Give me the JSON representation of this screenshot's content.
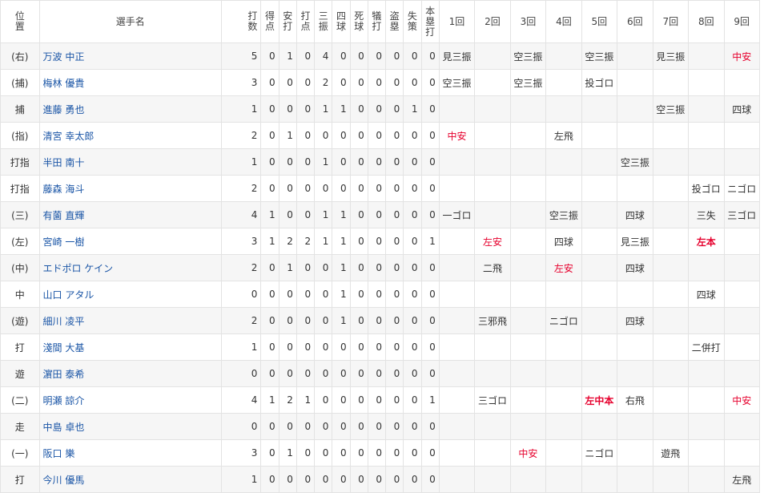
{
  "headers": {
    "position": "位置",
    "name": "選手名",
    "stats": [
      "打数",
      "得点",
      "安打",
      "打点",
      "三振",
      "四球",
      "死球",
      "犠打",
      "盗塁",
      "失策",
      "本塁打"
    ],
    "innings": [
      "1回",
      "2回",
      "3回",
      "4回",
      "5回",
      "6回",
      "7回",
      "8回",
      "9回"
    ]
  },
  "rows": [
    {
      "pos": "(右)",
      "name": "万波 中正",
      "stats": [
        "5",
        "0",
        "1",
        "0",
        "4",
        "0",
        "0",
        "0",
        "0",
        "0",
        "0"
      ],
      "innings": [
        {
          "t": "見三振"
        },
        {
          "t": ""
        },
        {
          "t": "空三振"
        },
        {
          "t": ""
        },
        {
          "t": "空三振"
        },
        {
          "t": ""
        },
        {
          "t": "見三振"
        },
        {
          "t": ""
        },
        {
          "t": "中安",
          "c": "hit"
        }
      ]
    },
    {
      "pos": "(捕)",
      "name": "梅林 優貴",
      "stats": [
        "3",
        "0",
        "0",
        "0",
        "2",
        "0",
        "0",
        "0",
        "0",
        "0",
        "0"
      ],
      "innings": [
        {
          "t": "空三振"
        },
        {
          "t": ""
        },
        {
          "t": "空三振"
        },
        {
          "t": ""
        },
        {
          "t": "投ゴロ"
        },
        {
          "t": ""
        },
        {
          "t": ""
        },
        {
          "t": ""
        },
        {
          "t": ""
        }
      ]
    },
    {
      "pos": "捕",
      "name": "進藤 勇也",
      "stats": [
        "1",
        "0",
        "0",
        "0",
        "1",
        "1",
        "0",
        "0",
        "0",
        "1",
        "0"
      ],
      "innings": [
        {
          "t": ""
        },
        {
          "t": ""
        },
        {
          "t": ""
        },
        {
          "t": ""
        },
        {
          "t": ""
        },
        {
          "t": ""
        },
        {
          "t": "空三振"
        },
        {
          "t": ""
        },
        {
          "t": "四球"
        }
      ]
    },
    {
      "pos": "(指)",
      "name": "清宮 幸太郎",
      "stats": [
        "2",
        "0",
        "1",
        "0",
        "0",
        "0",
        "0",
        "0",
        "0",
        "0",
        "0"
      ],
      "innings": [
        {
          "t": "中安",
          "c": "hit"
        },
        {
          "t": ""
        },
        {
          "t": ""
        },
        {
          "t": "左飛"
        },
        {
          "t": ""
        },
        {
          "t": ""
        },
        {
          "t": ""
        },
        {
          "t": ""
        },
        {
          "t": ""
        }
      ]
    },
    {
      "pos": "打指",
      "name": "半田 南十",
      "stats": [
        "1",
        "0",
        "0",
        "0",
        "1",
        "0",
        "0",
        "0",
        "0",
        "0",
        "0"
      ],
      "innings": [
        {
          "t": ""
        },
        {
          "t": ""
        },
        {
          "t": ""
        },
        {
          "t": ""
        },
        {
          "t": ""
        },
        {
          "t": "空三振"
        },
        {
          "t": ""
        },
        {
          "t": ""
        },
        {
          "t": ""
        }
      ]
    },
    {
      "pos": "打指",
      "name": "藤森 海斗",
      "stats": [
        "2",
        "0",
        "0",
        "0",
        "0",
        "0",
        "0",
        "0",
        "0",
        "0",
        "0"
      ],
      "innings": [
        {
          "t": ""
        },
        {
          "t": ""
        },
        {
          "t": ""
        },
        {
          "t": ""
        },
        {
          "t": ""
        },
        {
          "t": ""
        },
        {
          "t": ""
        },
        {
          "t": "投ゴロ"
        },
        {
          "t": "ニゴロ"
        }
      ]
    },
    {
      "pos": "(三)",
      "name": "有薗 直輝",
      "stats": [
        "4",
        "1",
        "0",
        "0",
        "1",
        "1",
        "0",
        "0",
        "0",
        "0",
        "0"
      ],
      "innings": [
        {
          "t": "一ゴロ"
        },
        {
          "t": ""
        },
        {
          "t": ""
        },
        {
          "t": "空三振"
        },
        {
          "t": ""
        },
        {
          "t": "四球"
        },
        {
          "t": ""
        },
        {
          "t": "三失"
        },
        {
          "t": "三ゴロ"
        }
      ]
    },
    {
      "pos": "(左)",
      "name": "宮崎 一樹",
      "stats": [
        "3",
        "1",
        "2",
        "2",
        "1",
        "1",
        "0",
        "0",
        "0",
        "0",
        "1"
      ],
      "innings": [
        {
          "t": ""
        },
        {
          "t": "左安",
          "c": "hit"
        },
        {
          "t": ""
        },
        {
          "t": "四球"
        },
        {
          "t": ""
        },
        {
          "t": "見三振"
        },
        {
          "t": ""
        },
        {
          "t": "左本",
          "c": "hr"
        },
        {
          "t": ""
        }
      ]
    },
    {
      "pos": "(中)",
      "name": "エドポロ ケイン",
      "stats": [
        "2",
        "0",
        "1",
        "0",
        "0",
        "1",
        "0",
        "0",
        "0",
        "0",
        "0"
      ],
      "innings": [
        {
          "t": ""
        },
        {
          "t": "二飛"
        },
        {
          "t": ""
        },
        {
          "t": "左安",
          "c": "hit"
        },
        {
          "t": ""
        },
        {
          "t": "四球"
        },
        {
          "t": ""
        },
        {
          "t": ""
        },
        {
          "t": ""
        }
      ]
    },
    {
      "pos": "中",
      "name": "山口 アタル",
      "stats": [
        "0",
        "0",
        "0",
        "0",
        "0",
        "1",
        "0",
        "0",
        "0",
        "0",
        "0"
      ],
      "innings": [
        {
          "t": ""
        },
        {
          "t": ""
        },
        {
          "t": ""
        },
        {
          "t": ""
        },
        {
          "t": ""
        },
        {
          "t": ""
        },
        {
          "t": ""
        },
        {
          "t": "四球"
        },
        {
          "t": ""
        }
      ]
    },
    {
      "pos": "(遊)",
      "name": "細川 凌平",
      "stats": [
        "2",
        "0",
        "0",
        "0",
        "0",
        "1",
        "0",
        "0",
        "0",
        "0",
        "0"
      ],
      "innings": [
        {
          "t": ""
        },
        {
          "t": "三邪飛"
        },
        {
          "t": ""
        },
        {
          "t": "ニゴロ"
        },
        {
          "t": ""
        },
        {
          "t": "四球"
        },
        {
          "t": ""
        },
        {
          "t": ""
        },
        {
          "t": ""
        }
      ]
    },
    {
      "pos": "打",
      "name": "淺間 大基",
      "stats": [
        "1",
        "0",
        "0",
        "0",
        "0",
        "0",
        "0",
        "0",
        "0",
        "0",
        "0"
      ],
      "innings": [
        {
          "t": ""
        },
        {
          "t": ""
        },
        {
          "t": ""
        },
        {
          "t": ""
        },
        {
          "t": ""
        },
        {
          "t": ""
        },
        {
          "t": ""
        },
        {
          "t": "二併打"
        },
        {
          "t": ""
        }
      ]
    },
    {
      "pos": "遊",
      "name": "濵田 泰希",
      "stats": [
        "0",
        "0",
        "0",
        "0",
        "0",
        "0",
        "0",
        "0",
        "0",
        "0",
        "0"
      ],
      "innings": [
        {
          "t": ""
        },
        {
          "t": ""
        },
        {
          "t": ""
        },
        {
          "t": ""
        },
        {
          "t": ""
        },
        {
          "t": ""
        },
        {
          "t": ""
        },
        {
          "t": ""
        },
        {
          "t": ""
        }
      ]
    },
    {
      "pos": "(二)",
      "name": "明瀬 諒介",
      "stats": [
        "4",
        "1",
        "2",
        "1",
        "0",
        "0",
        "0",
        "0",
        "0",
        "0",
        "1"
      ],
      "innings": [
        {
          "t": ""
        },
        {
          "t": "三ゴロ"
        },
        {
          "t": ""
        },
        {
          "t": ""
        },
        {
          "t": "左中本",
          "c": "hr"
        },
        {
          "t": "右飛"
        },
        {
          "t": ""
        },
        {
          "t": ""
        },
        {
          "t": "中安",
          "c": "hit"
        }
      ]
    },
    {
      "pos": "走",
      "name": "中島 卓也",
      "stats": [
        "0",
        "0",
        "0",
        "0",
        "0",
        "0",
        "0",
        "0",
        "0",
        "0",
        "0"
      ],
      "innings": [
        {
          "t": ""
        },
        {
          "t": ""
        },
        {
          "t": ""
        },
        {
          "t": ""
        },
        {
          "t": ""
        },
        {
          "t": ""
        },
        {
          "t": ""
        },
        {
          "t": ""
        },
        {
          "t": ""
        }
      ]
    },
    {
      "pos": "(一)",
      "name": "阪口 樂",
      "stats": [
        "3",
        "0",
        "1",
        "0",
        "0",
        "0",
        "0",
        "0",
        "0",
        "0",
        "0"
      ],
      "innings": [
        {
          "t": ""
        },
        {
          "t": ""
        },
        {
          "t": "中安",
          "c": "hit"
        },
        {
          "t": ""
        },
        {
          "t": "ニゴロ"
        },
        {
          "t": ""
        },
        {
          "t": "遊飛"
        },
        {
          "t": ""
        },
        {
          "t": ""
        }
      ]
    },
    {
      "pos": "打",
      "name": "今川 優馬",
      "stats": [
        "1",
        "0",
        "0",
        "0",
        "0",
        "0",
        "0",
        "0",
        "0",
        "0",
        "0"
      ],
      "innings": [
        {
          "t": ""
        },
        {
          "t": ""
        },
        {
          "t": ""
        },
        {
          "t": ""
        },
        {
          "t": ""
        },
        {
          "t": ""
        },
        {
          "t": ""
        },
        {
          "t": ""
        },
        {
          "t": "左飛"
        }
      ]
    }
  ]
}
